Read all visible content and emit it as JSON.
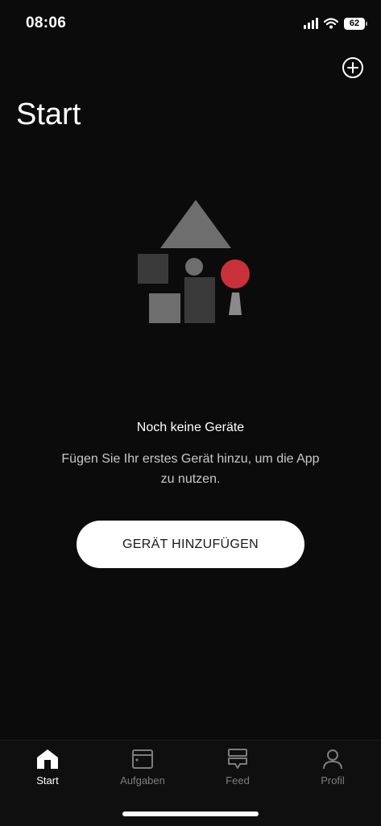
{
  "status_bar": {
    "time": "08:06",
    "battery": "62"
  },
  "header": {
    "title": "Start",
    "add_icon": "plus-circle-icon"
  },
  "empty_state": {
    "illustration": "devices-house-illustration",
    "title": "Noch keine Geräte",
    "description": "Fügen Sie Ihr erstes Gerät hinzu, um die App zu nutzen.",
    "button_label": "GERÄT HINZUFÜGEN"
  },
  "tab_bar": {
    "items": [
      {
        "label": "Start",
        "icon": "home-icon",
        "active": true
      },
      {
        "label": "Aufgaben",
        "icon": "tasks-icon",
        "active": false
      },
      {
        "label": "Feed",
        "icon": "feed-icon",
        "active": false
      },
      {
        "label": "Profil",
        "icon": "profile-icon",
        "active": false
      }
    ]
  },
  "colors": {
    "background": "#0b0b0b",
    "accent": "#c8313a",
    "button": "#ffffff",
    "inactive": "#7d7d7d"
  }
}
